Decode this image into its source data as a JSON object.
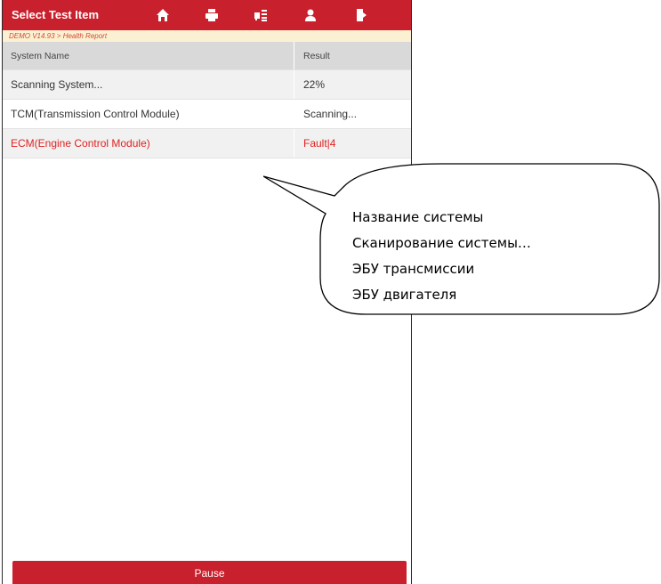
{
  "header": {
    "title": "Select Test Item",
    "icons": [
      "home-icon",
      "print-icon",
      "vehicle-info-icon",
      "user-icon",
      "exit-icon"
    ]
  },
  "breadcrumb": "DEMO V14.93 > Health Report",
  "table": {
    "columns": [
      "System Name",
      "Result"
    ],
    "rows": [
      {
        "name": "Scanning System...",
        "result": "22%"
      },
      {
        "name": "TCM(Transmission Control Module)",
        "result": "Scanning..."
      },
      {
        "name": "ECM(Engine Control Module)",
        "result": "Fault|4",
        "status": "fault"
      }
    ]
  },
  "footer": {
    "pause_label": "Pause"
  },
  "callout": {
    "lines": [
      "Название системы",
      "Сканирование системы…",
      "ЭБУ трансмиссии",
      "ЭБУ двигателя"
    ]
  },
  "colors": {
    "accent": "#c8202c",
    "fault_text": "#e02222",
    "breadcrumb_bg": "#fbf1d2"
  }
}
